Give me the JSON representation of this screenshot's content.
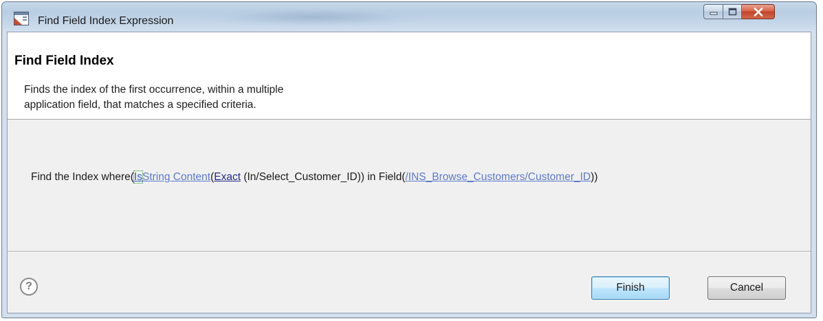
{
  "window": {
    "title": "Find Field Index Expression",
    "icon": "dialog-app-icon",
    "controls": {
      "minimize": "minimize-icon",
      "maximize": "maximize-icon",
      "close": "close-icon"
    }
  },
  "header": {
    "title": "Find Field Index",
    "description_line1": "Finds the index of the first occurrence, within a multiple",
    "description_line2": "application field, that matches a specified criteria."
  },
  "expression": {
    "prefix": "Find the Index where(",
    "is_link": "Is",
    "condition_link": "String Content",
    "open_paren": "(",
    "exact_link": "Exact",
    "value_text": " (In/Select_Customer_ID)) in Field(",
    "field_link": "/INS_Browse_Customers/Customer_ID",
    "suffix": "))"
  },
  "footer": {
    "help_icon": "help-icon",
    "help_glyph": "?",
    "finish_label": "Finish",
    "cancel_label": "Cancel"
  }
}
